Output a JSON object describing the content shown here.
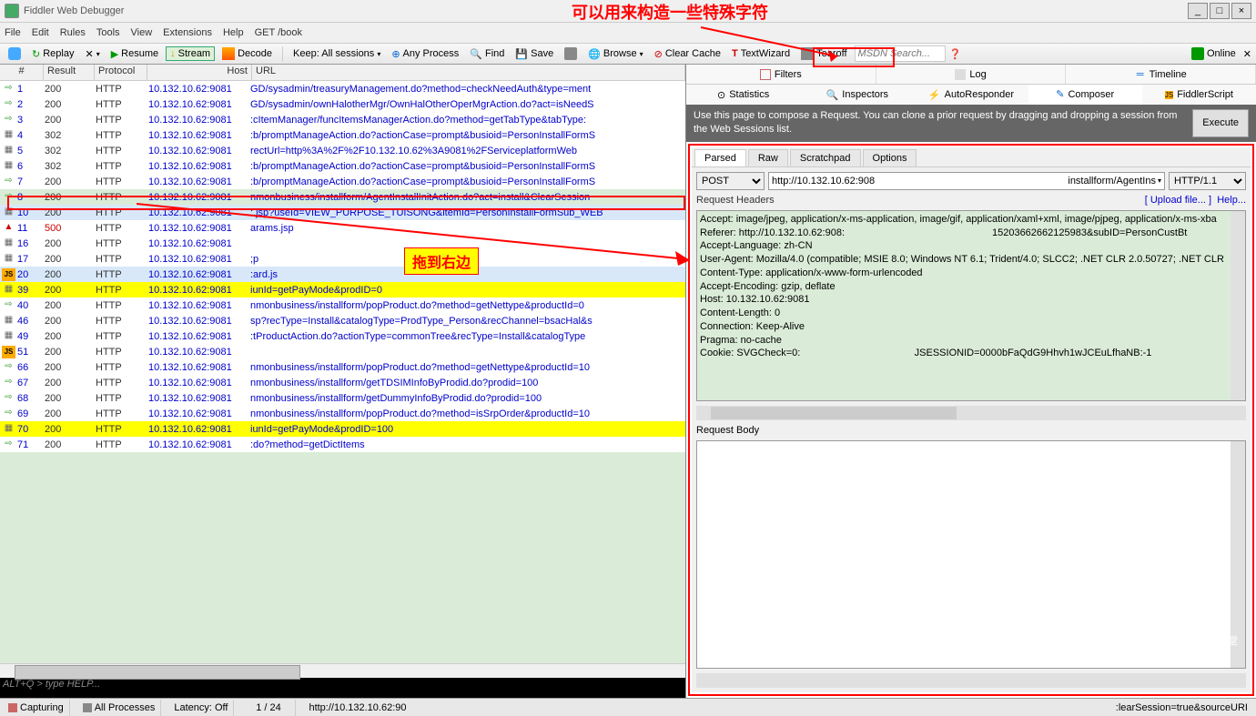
{
  "title": "Fiddler Web Debugger",
  "menubar": [
    "File",
    "Edit",
    "Rules",
    "Tools",
    "View",
    "Extensions",
    "Help",
    "GET /book"
  ],
  "annotations": {
    "top": "可以用来构造一些特殊字符",
    "middle": "拖到右边"
  },
  "toolbar": {
    "replay": "Replay",
    "resume": "Resume",
    "stream": "Stream",
    "decode": "Decode",
    "keep": "Keep: All sessions",
    "anyprocess": "Any Process",
    "find": "Find",
    "save": "Save",
    "browse": "Browse",
    "clearcache": "Clear Cache",
    "textwizard": "TextWizard",
    "tearoff": "Tearoff",
    "search_placeholder": "MSDN Search...",
    "online": "Online"
  },
  "sessions_header": {
    "num": "#",
    "result": "Result",
    "protocol": "Protocol",
    "host": "Host",
    "url": "URL"
  },
  "sessions": [
    {
      "n": "1",
      "r": "200",
      "p": "HTTP",
      "h": "10.132.10.62:9081",
      "u": "GD/sysadmin/treasuryManagement.do?method=checkNeedAuth&type=ment",
      "c": "g"
    },
    {
      "n": "2",
      "r": "200",
      "p": "HTTP",
      "h": "10.132.10.62:9081",
      "u": "GD/sysadmin/ownHalotherMgr/OwnHalOtherOperMgrAction.do?act=isNeedS",
      "c": "g"
    },
    {
      "n": "3",
      "r": "200",
      "p": "HTTP",
      "h": "10.132.10.62:9081",
      "u": ":cItemManager/funcItemsManagerAction.do?method=getTabType&tabType:",
      "c": "g"
    },
    {
      "n": "4",
      "r": "302",
      "p": "HTTP",
      "h": "10.132.10.62:9081",
      "u": ":b/promptManageAction.do?actionCase=prompt&busioid=PersonInstallFormS",
      "c": "d"
    },
    {
      "n": "5",
      "r": "302",
      "p": "HTTP",
      "h": "10.132.10.62:9081",
      "u": "rectUrl=http%3A%2F%2F10.132.10.62%3A9081%2FServiceplatformWeb",
      "c": "d"
    },
    {
      "n": "6",
      "r": "302",
      "p": "HTTP",
      "h": "10.132.10.62:9081",
      "u": ":b/promptManageAction.do?actionCase=prompt&busioid=PersonInstallFormS",
      "c": "d"
    },
    {
      "n": "7",
      "r": "200",
      "p": "HTTP",
      "h": "10.132.10.62:9081",
      "u": ":b/promptManageAction.do?actionCase=prompt&busioid=PersonInstallFormS",
      "c": "g"
    },
    {
      "n": "8",
      "r": "200",
      "p": "HTTP",
      "h": "10.132.10.62:9081",
      "u": "nmonbusiness/installform/AgentInstallInitAction.do?act=install&ClearSession",
      "c": "g",
      "sel": "green",
      "hl": true
    },
    {
      "n": "10",
      "r": "200",
      "p": "HTTP",
      "h": "10.132.10.62:9081",
      "u": ":.jsp?useId=VIEW_PURPOSE_TUISONG&itemId=PersonInstallFormSub_WEB",
      "c": "x",
      "sel": "blue"
    },
    {
      "n": "11",
      "r": "500",
      "p": "HTTP",
      "h": "10.132.10.62:9081",
      "u": "arams.jsp",
      "c": "e",
      "err": true
    },
    {
      "n": "16",
      "r": "200",
      "p": "HTTP",
      "h": "10.132.10.62:9081",
      "u": "",
      "c": "d"
    },
    {
      "n": "17",
      "r": "200",
      "p": "HTTP",
      "h": "10.132.10.62:9081",
      "u": ";p",
      "c": "x"
    },
    {
      "n": "20",
      "r": "200",
      "p": "HTTP",
      "h": "10.132.10.62:9081",
      "u": ":ard.js",
      "c": "js",
      "sel": "blue"
    },
    {
      "n": "39",
      "r": "200",
      "p": "HTTP",
      "h": "10.132.10.62:9081",
      "u": "iunId=getPayMode&prodID=0",
      "c": "x",
      "yellow": true
    },
    {
      "n": "40",
      "r": "200",
      "p": "HTTP",
      "h": "10.132.10.62:9081",
      "u": "nmonbusiness/installform/popProduct.do?method=getNettype&productId=0",
      "c": "g"
    },
    {
      "n": "46",
      "r": "200",
      "p": "HTTP",
      "h": "10.132.10.62:9081",
      "u": "sp?recType=Install&catalogType=ProdType_Person&recChannel=bsacHal&s",
      "c": "d"
    },
    {
      "n": "49",
      "r": "200",
      "p": "HTTP",
      "h": "10.132.10.62:9081",
      "u": ":tProductAction.do?actionType=commonTree&recType=Install&catalogType",
      "c": "d"
    },
    {
      "n": "51",
      "r": "200",
      "p": "HTTP",
      "h": "10.132.10.62:9081",
      "u": "",
      "c": "js"
    },
    {
      "n": "66",
      "r": "200",
      "p": "HTTP",
      "h": "10.132.10.62:9081",
      "u": "nmonbusiness/installform/popProduct.do?method=getNettype&productId=10",
      "c": "g"
    },
    {
      "n": "67",
      "r": "200",
      "p": "HTTP",
      "h": "10.132.10.62:9081",
      "u": "nmonbusiness/installform/getTDSIMInfoByProdid.do?prodid=100",
      "c": "g"
    },
    {
      "n": "68",
      "r": "200",
      "p": "HTTP",
      "h": "10.132.10.62:9081",
      "u": "nmonbusiness/installform/getDummyInfoByProdid.do?prodid=100",
      "c": "g"
    },
    {
      "n": "69",
      "r": "200",
      "p": "HTTP",
      "h": "10.132.10.62:9081",
      "u": "nmonbusiness/installform/popProduct.do?method=isSrpOrder&productId=10",
      "c": "g"
    },
    {
      "n": "70",
      "r": "200",
      "p": "HTTP",
      "h": "10.132.10.62:9081",
      "u": "iunId=getPayMode&prodID=100",
      "c": "x",
      "yellow": true
    },
    {
      "n": "71",
      "r": "200",
      "p": "HTTP",
      "h": "10.132.10.62:9081",
      "u": ":do?method=getDictItems",
      "c": "g"
    }
  ],
  "quickexec": "ALT+Q > type HELP...",
  "right_tabs1": [
    "Filters",
    "Log",
    "Timeline"
  ],
  "right_tabs2": [
    "Statistics",
    "Inspectors",
    "AutoResponder",
    "Composer",
    "FiddlerScript"
  ],
  "composer": {
    "tip": "Use this page to compose a Request. You can clone a prior request by dragging and dropping a session from the Web Sessions list.",
    "execute": "Execute",
    "tabs": [
      "Parsed",
      "Raw",
      "Scratchpad",
      "Options"
    ],
    "method": "POST",
    "url_pre": "http://10.132.10.62:908",
    "url_post": "installform/AgentIns",
    "httpver": "HTTP/1.1",
    "req_headers_label": "Request Headers",
    "upload_link": "[ Upload file... ]",
    "help_link": "Help...",
    "headers_text": "Accept: image/jpeg, application/x-ms-application, image/gif, application/xaml+xml, image/pjpeg, application/x-ms-xba\nReferer: http://10.132.10.62:908:                                                     15203662662125983&subID=PersonCustBt\nAccept-Language: zh-CN\nUser-Agent: Mozilla/4.0 (compatible; MSIE 8.0; Windows NT 6.1; Trident/4.0; SLCC2; .NET CLR 2.0.50727; .NET CLR\nContent-Type: application/x-www-form-urlencoded\nAccept-Encoding: gzip, deflate\nHost: 10.132.10.62:9081\nContent-Length: 0\nConnection: Keep-Alive\nPragma: no-cache\nCookie: SVGCheck=0:                                         JSESSIONID=0000bFaQdG9Hhvh1wJCEuLfhaNB:-1",
    "req_body_label": "Request Body"
  },
  "statusbar": {
    "capturing": "Capturing",
    "processes": "All Processes",
    "latency": "Latency: Off",
    "count": "1 / 24",
    "url": "http://10.132.10.62:90",
    "right": ":learSession=true&sourceURI"
  },
  "watermark": "HTML5学堂"
}
